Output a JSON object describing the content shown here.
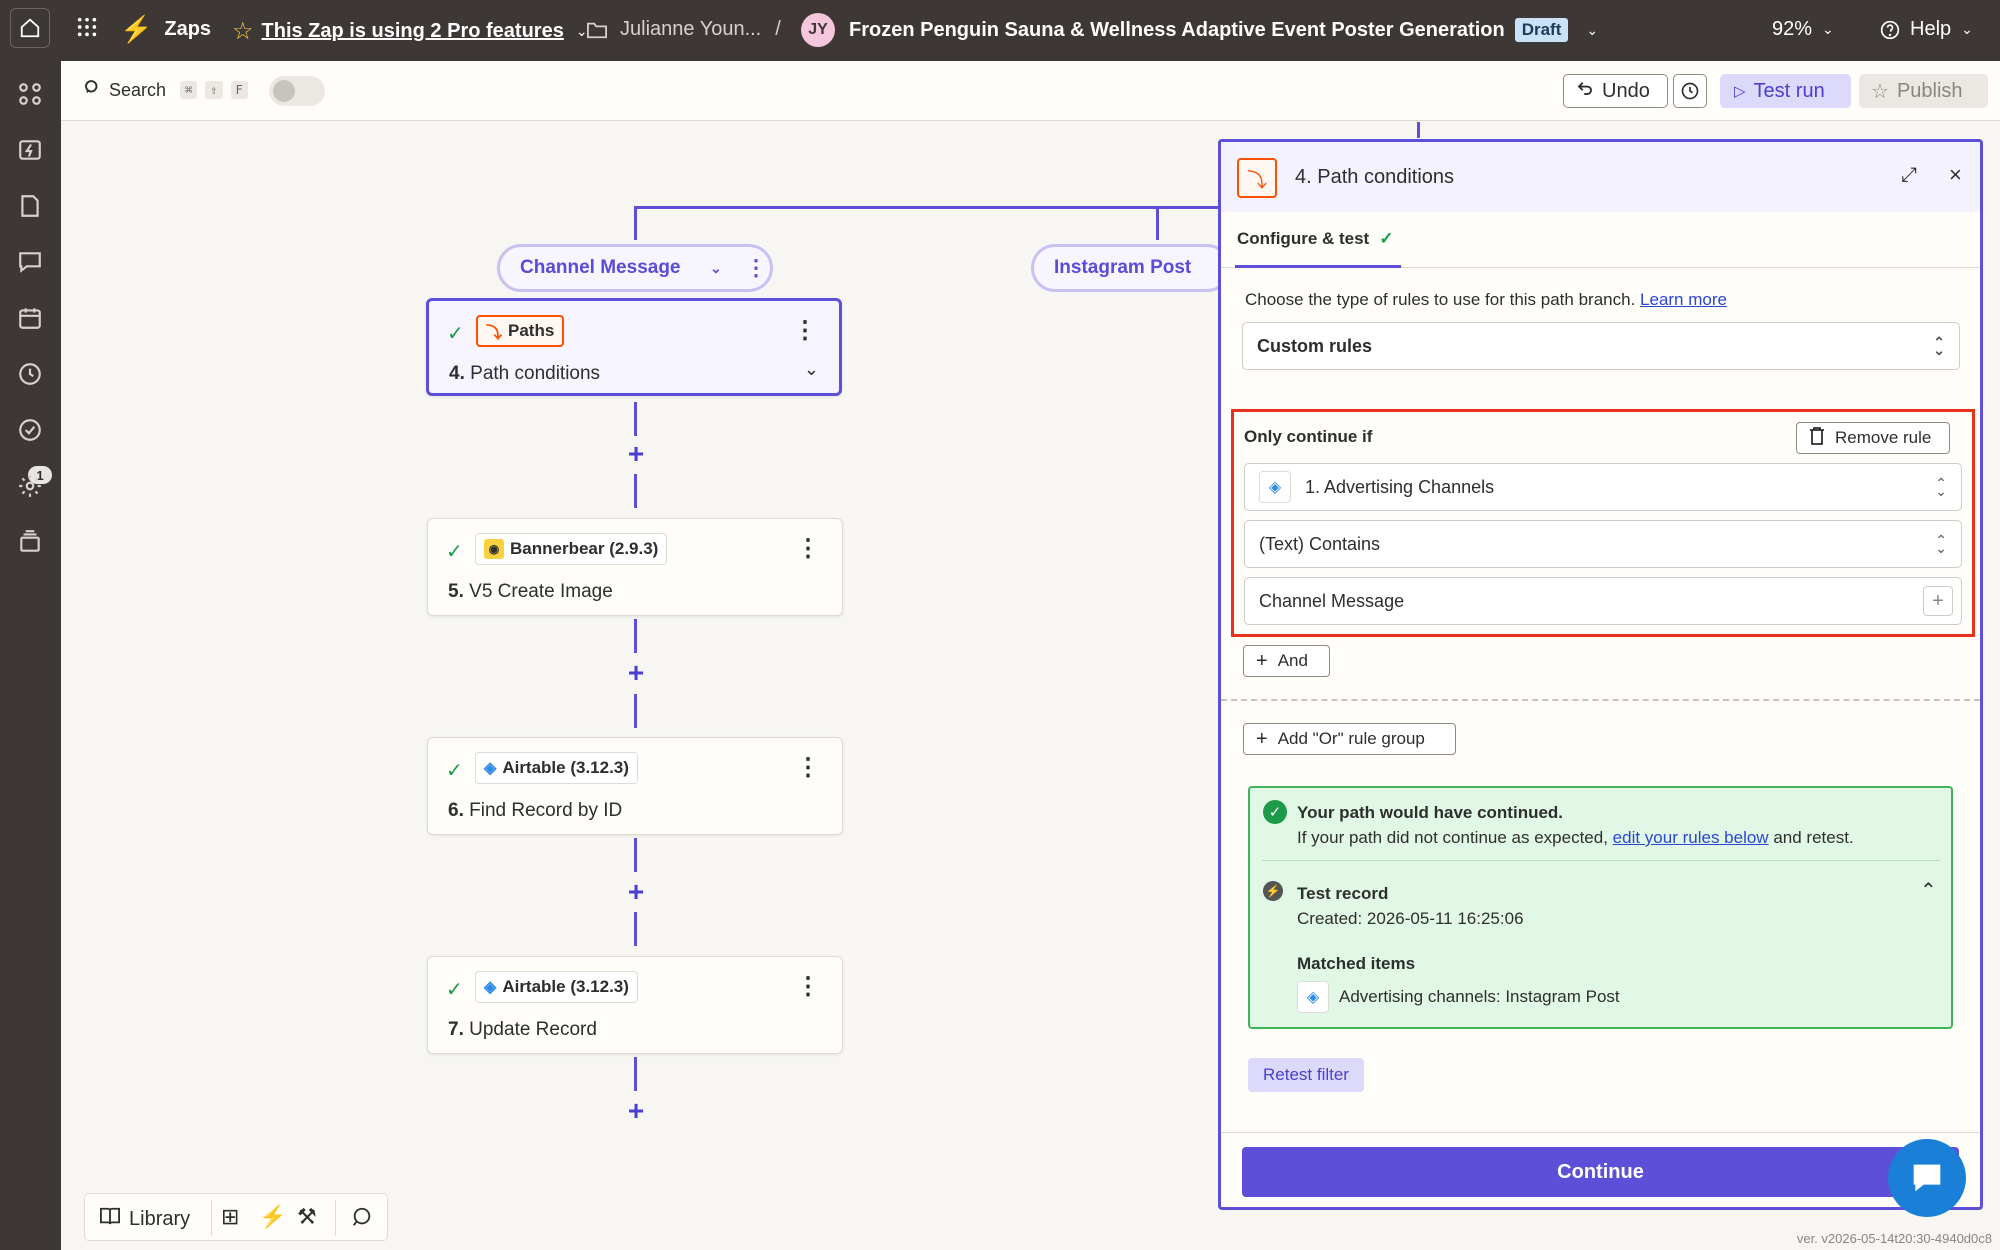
{
  "topbar": {
    "app_name": "Zaps",
    "pro_notice": "This Zap is using 2 Pro features",
    "folder": "Julianne Youn...",
    "separator": "/",
    "avatar_initials": "JY",
    "zap_title": "Frozen Penguin Sauna & Wellness Adaptive Event Poster Generation",
    "status_badge": "Draft",
    "zoom": "92%",
    "help": "Help"
  },
  "sidebar": {
    "notification_count": "1"
  },
  "toolbar": {
    "search_label": "Search",
    "shortcut_keys": [
      "⌘",
      "⇧",
      "F"
    ],
    "undo_label": "Undo",
    "test_run_label": "Test run",
    "publish_label": "Publish"
  },
  "canvas": {
    "branches": [
      {
        "label": "Channel Message"
      },
      {
        "label": "Instagram Post"
      }
    ],
    "steps": [
      {
        "app": "Paths",
        "number": "4.",
        "title": "Path conditions"
      },
      {
        "app": "Bannerbear (2.9.3)",
        "number": "5.",
        "title": "V5 Create Image"
      },
      {
        "app": "Airtable (3.12.3)",
        "number": "6.",
        "title": "Find Record by ID"
      },
      {
        "app": "Airtable (3.12.3)",
        "number": "7.",
        "title": "Update Record"
      }
    ]
  },
  "panel": {
    "number": "4.",
    "title": "Path conditions",
    "tab_label": "Configure & test",
    "rules_prompt": "Choose the type of rules to use for this path branch.",
    "learn_more": "Learn more",
    "rule_type": "Custom rules",
    "only_continue": "Only continue if",
    "remove_rule": "Remove rule",
    "field": "1. Advertising Channels",
    "condition": "(Text) Contains",
    "value": "Channel Message",
    "and_label": "And",
    "or_label": "Add \"Or\" rule group",
    "result_title": "Your path would have continued.",
    "result_text_before": "If your path did not continue as expected,",
    "result_link": "edit your rules below",
    "result_text_after": "and retest.",
    "test_record_title": "Test record",
    "test_record_created": "Created: 2026-05-11 16:25:06",
    "matched_items_title": "Matched items",
    "matched_item": "Advertising channels: Instagram Post",
    "retest_label": "Retest filter",
    "continue_label": "Continue"
  },
  "bottom_toolbar": {
    "library_label": "Library"
  },
  "version": "ver. v2026-05-14t20:30-4940d0c8",
  "colors": {
    "brand_purple": "#5d4fd8",
    "zap_orange": "#ff4f00",
    "success_green": "#41b35a",
    "highlight_red": "#e8321c"
  }
}
